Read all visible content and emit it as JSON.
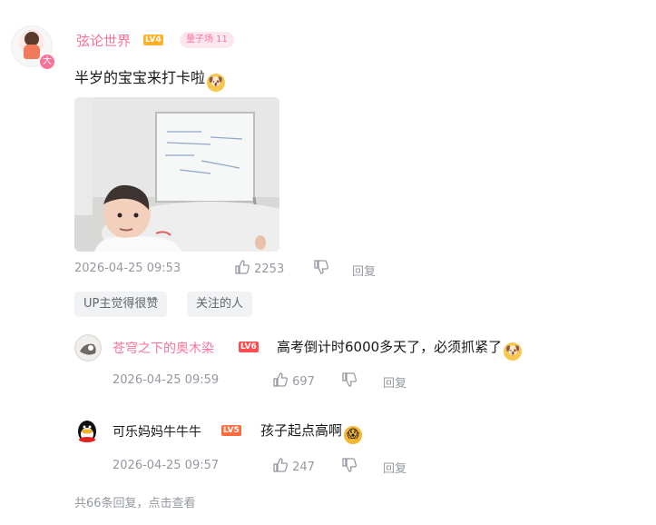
{
  "main_comment": {
    "username": "弦论世界",
    "level": "LV4",
    "medal": "量子场 11",
    "avatar_badge": "大",
    "content": "半岁的宝宝来打卡啦",
    "timestamp": "2026-04-25 09:53",
    "likes": "2253",
    "reply_label": "回复",
    "tags": [
      "UP主觉得很赞",
      "关注的人"
    ]
  },
  "replies": [
    {
      "username": "苍穹之下的奥木染",
      "level": "LV6",
      "content": "高考倒计时6000多天了，必须抓紧了",
      "timestamp": "2026-04-25 09:59",
      "likes": "697",
      "reply_label": "回复"
    },
    {
      "username": "可乐妈妈牛牛牛",
      "level": "LV5",
      "content": "孩子起点高啊",
      "timestamp": "2026-04-25 09:57",
      "likes": "247",
      "reply_label": "回复"
    }
  ],
  "view_more": "共66条回复，点击查看",
  "colors": {
    "accent_pink": "#fb7299",
    "meta_gray": "#9499a0",
    "lv4": "#ffb027",
    "lv6": "#ff4d4f",
    "lv5": "#ff6b3d"
  },
  "icons": [
    "thumbs-up-icon",
    "thumbs-down-icon",
    "doge-emoji-icon",
    "shocked-emoji-icon"
  ]
}
